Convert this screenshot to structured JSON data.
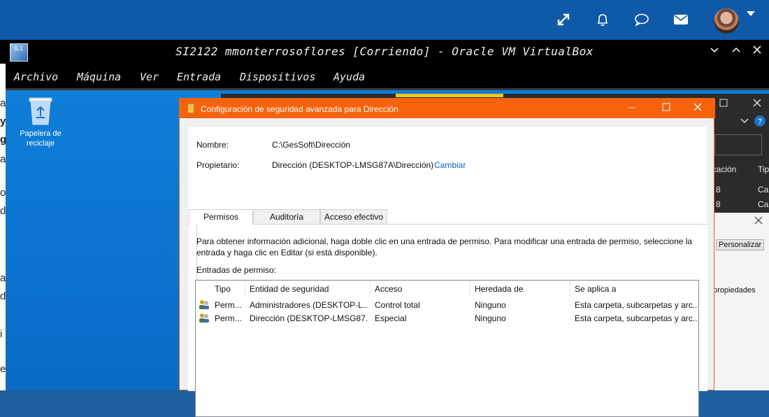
{
  "vbox": {
    "title": "SI2122 mmonterrosoflores [Corriendo] - Oracle VM VirtualBox",
    "logo": "6.1",
    "menu": [
      "Archivo",
      "Máquina",
      "Ver",
      "Entrada",
      "Dispositivos",
      "Ayuda"
    ]
  },
  "topbar": {
    "icons": [
      "expand-icon",
      "bell-icon",
      "chat-icon",
      "mail-icon"
    ]
  },
  "desktop": {
    "recycle_bin_label": "Papelera de reciclaje"
  },
  "left_strip": [
    "a",
    "y",
    "g",
    "a",
    "o",
    "d",
    "a",
    "d",
    "i",
    "e"
  ],
  "back_window": {
    "col1": "icación",
    "col2": "Tip",
    "row1a": "8",
    "row1b": "Ca",
    "row2a": "8",
    "row2b": "Ca",
    "personalizar": "Personalizar",
    "propiedades": "propiedades"
  },
  "dialog": {
    "title": "Configuración de seguridad avanzada para Dirección",
    "name_label": "Nombre:",
    "name_value": "C:\\GesSoft\\Dirección",
    "owner_label": "Propietario:",
    "owner_value": "Dirección (DESKTOP-LMSG87A\\Dirección)",
    "change_link": "Cambiar",
    "tabs": [
      "Permisos",
      "Auditoría",
      "Acceso efectivo"
    ],
    "info": "Para obtener información adicional, haga doble clic en una entrada de permiso. Para modificar una entrada de permiso, seleccione la entrada y haga clic en Editar (si está disponible).",
    "entries_label": "Entradas de permiso:",
    "columns": [
      "Tipo",
      "Entidad de seguridad",
      "Acceso",
      "Heredada de",
      "Se aplica a"
    ],
    "rows": [
      {
        "tipo": "Perm...",
        "entidad": "Administradores (DESKTOP-L...",
        "acceso": "Control total",
        "heredada": "Ninguno",
        "aplica": "Esta carpeta, subcarpetas y arc..."
      },
      {
        "tipo": "Perm...",
        "entidad": "Dirección (DESKTOP-LMSG87...",
        "acceso": "Especial",
        "heredada": "Ninguno",
        "aplica": "Esta carpeta, subcarpetas y arc..."
      }
    ]
  }
}
